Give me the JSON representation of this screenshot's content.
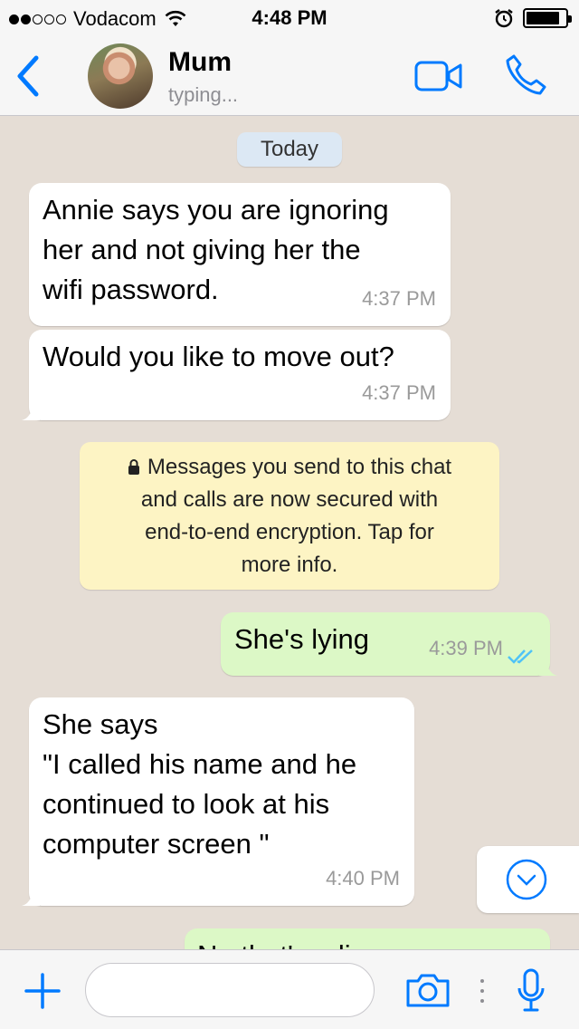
{
  "status_bar": {
    "carrier": "Vodacom",
    "time": "4:48 PM",
    "signal_bars": 2,
    "signal_total": 5,
    "battery_level": 0.85
  },
  "header": {
    "contact_name": "Mum",
    "contact_status": "typing..."
  },
  "chat": {
    "date_label": "Today",
    "messages": [
      {
        "direction": "in",
        "text": "Annie says you are ignoring\nher and not giving her the\nwifi password.",
        "time": "4:37 PM"
      },
      {
        "direction": "in",
        "text": "Would you like to move out?",
        "time": "4:37 PM"
      },
      {
        "direction": "out",
        "text": "She's lying",
        "time": "4:39 PM",
        "status": "read"
      },
      {
        "direction": "in",
        "text": "She says\n\"I called his name and he\ncontinued to look at his\ncomputer screen \"",
        "time": "4:40 PM"
      },
      {
        "direction": "out",
        "text": "No that's a lie"
      }
    ],
    "encryption_notice": [
      "Messages you send to this chat",
      "and calls are now secured with",
      "end-to-end encryption. Tap for",
      "more info."
    ]
  },
  "input": {
    "placeholder": ""
  },
  "colors": {
    "accent": "#007aff",
    "chat_background": "#e5ddd5",
    "incoming_bubble": "#ffffff",
    "outgoing_bubble": "#dcf8c6",
    "notice_background": "#fdf4c4",
    "read_ticks": "#4fc3f7"
  },
  "icons": [
    "back-icon",
    "video-call-icon",
    "phone-icon",
    "lock-icon",
    "double-check-icon",
    "chevron-down-icon",
    "plus-icon",
    "camera-icon",
    "microphone-icon",
    "alarm-icon",
    "wifi-icon",
    "battery-icon"
  ]
}
